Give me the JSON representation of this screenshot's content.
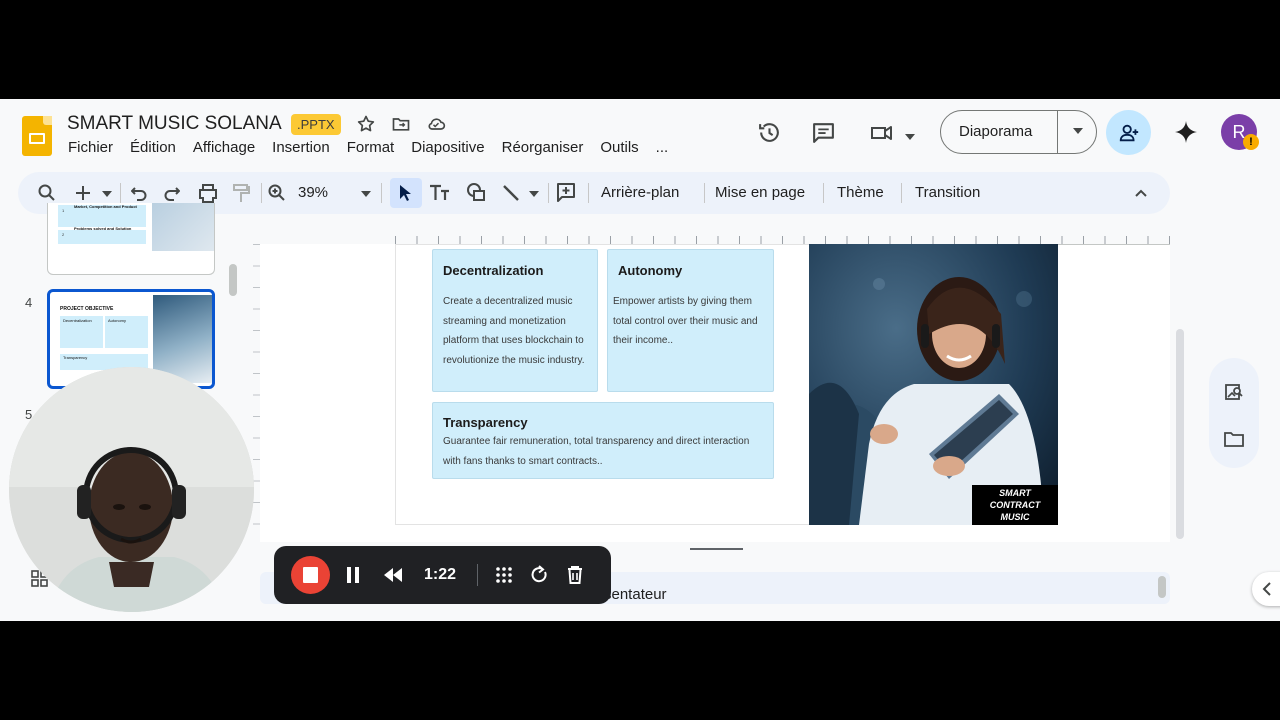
{
  "header": {
    "title": "SMART MUSIC SOLANA",
    "badge": ".PPTX",
    "menu": [
      "Fichier",
      "Édition",
      "Affichage",
      "Insertion",
      "Format",
      "Diapositive",
      "Réorganiser",
      "Outils",
      "..."
    ],
    "present_label": "Diaporama",
    "avatar_letter": "R",
    "avatar_alert": "!"
  },
  "toolbar": {
    "zoom": "39%",
    "background_label": "Arrière-plan",
    "layout_label": "Mise en page",
    "theme_label": "Thème",
    "transition_label": "Transition"
  },
  "filmstrip": {
    "numbers": [
      "4",
      "5"
    ],
    "thumb3": {
      "row1_num": "1",
      "row1_title": "Market, Competition and Product",
      "row2_num": "2",
      "row2_title": "Problems solved and Solution"
    },
    "thumb4": {
      "title": "PROJECT OBJECTIVE",
      "card1": "Decentralization",
      "card2": "Autonomy",
      "card3": "Transparency"
    }
  },
  "slide": {
    "cards": [
      {
        "title": "Decentralization",
        "body": "Create a decentralized music streaming and monetization platform that uses blockchain to revolutionize the music industry."
      },
      {
        "title": "Autonomy",
        "body": "Empower artists by giving them total control over their music and their income.."
      },
      {
        "title": "Transparency",
        "body": "Guarantee fair remuneration, total transparency and direct interaction with fans thanks to smart contracts.."
      }
    ],
    "photo_caption": "SMART CONTRACT MUSIC"
  },
  "notes": {
    "label": "sentateur"
  },
  "recorder": {
    "time": "1:22"
  },
  "colors": {
    "accent": "#0b57d0",
    "card_bg": "#d0eefb",
    "record_red": "#ea4335",
    "slides_yellow": "#f4b400"
  }
}
